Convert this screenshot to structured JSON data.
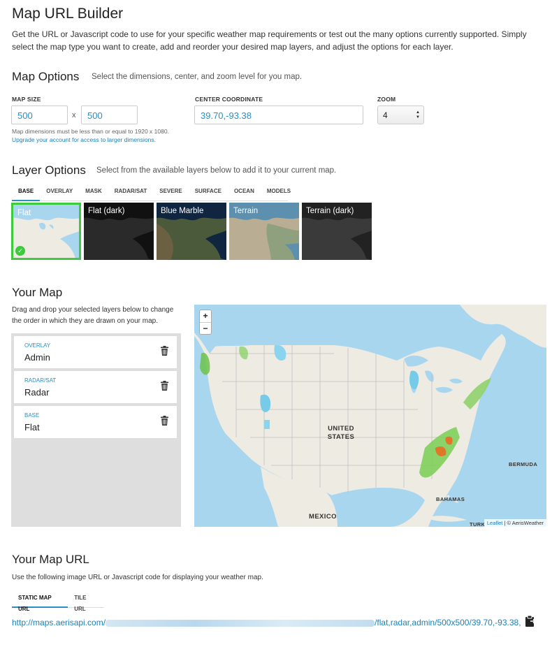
{
  "page": {
    "title": "Map URL Builder",
    "intro": "Get the URL or Javascript code to use for your specific weather map requirements or test out the many options currently supported. Simply select the map type you want to create, add and reorder your desired map layers, and adjust the options for each layer."
  },
  "map_options": {
    "heading": "Map Options",
    "subheading": "Select the dimensions, center, and zoom level for you map.",
    "size_label": "MAP SIZE",
    "width_value": "500",
    "times": "x",
    "height_value": "500",
    "size_note": "Map dimensions must be less than or equal to 1920 x 1080.",
    "upgrade_link": "Upgrade your account for access to larger dimensions.",
    "center_label": "CENTER COORDINATE",
    "center_value": "39.70,-93.38",
    "zoom_label": "ZOOM",
    "zoom_value": "4"
  },
  "layer_options": {
    "heading": "Layer Options",
    "subheading": "Select from the available layers below to add it to your current map.",
    "tabs": [
      "BASE",
      "OVERLAY",
      "MASK",
      "RADAR/SAT",
      "SEVERE",
      "SURFACE",
      "OCEAN",
      "MODELS"
    ],
    "thumbnails": [
      {
        "label": "Flat",
        "selected": true
      },
      {
        "label": "Flat (dark)",
        "selected": false
      },
      {
        "label": "Blue Marble",
        "selected": false
      },
      {
        "label": "Terrain",
        "selected": false
      },
      {
        "label": "Terrain (dark)",
        "selected": false
      }
    ]
  },
  "your_map": {
    "heading": "Your Map",
    "description": "Drag and drop your selected layers below to change the order in which they are drawn on your map.",
    "layers": [
      {
        "type": "OVERLAY",
        "name": "Admin"
      },
      {
        "type": "RADAR/SAT",
        "name": "Radar"
      },
      {
        "type": "BASE",
        "name": "Flat"
      }
    ],
    "zoom_in": "+",
    "zoom_out": "−",
    "map_labels": {
      "united_states": "UNITED STATES",
      "mexico": "MEXICO",
      "bermuda": "BERMUDA",
      "bahamas": "BAHAMAS",
      "turk": "TURK"
    },
    "attribution_link": "Leaflet",
    "attribution_text": " | © AerisWeather"
  },
  "map_url": {
    "heading": "Your Map URL",
    "description": "Use the following image URL or Javascript code for displaying your weather map.",
    "tabs": [
      "STATIC MAP URL",
      "TILE URL"
    ],
    "url_prefix": "http://maps.aerisapi.com/",
    "url_suffix": "/flat,radar,admin/500x500/39.70,-93.38,"
  },
  "icons": {
    "trash": "trash-icon",
    "check": "check-icon",
    "clipboard": "clipboard-icon"
  },
  "colors": {
    "accent": "#2a8fc4",
    "selected_border": "#3fc93f",
    "water": "#a9d6ef",
    "land": "#eeebe3"
  }
}
